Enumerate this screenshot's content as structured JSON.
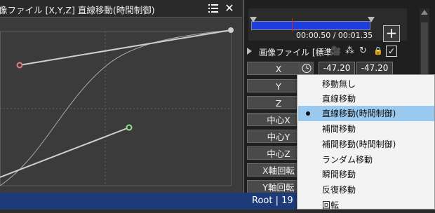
{
  "curve_editor": {
    "title": "像ファイル [X,Y,Z] 直線移動(時間制御)",
    "list_icon": "list-icon",
    "close_icon": "close-icon",
    "close_glyph": "✕"
  },
  "timeline": {
    "time_display": "00:00.50 / 00:01.35",
    "add_label": "+"
  },
  "object": {
    "name": "画像ファイル [標準",
    "icons": [
      "expand-triangle-icon",
      "camera-icon",
      "scatter-icon",
      "refresh-icon",
      "lock-icon",
      "check-icon"
    ],
    "camera_glyph": "🎥",
    "scatter_glyph": "⁂",
    "refresh_glyph": "↻",
    "lock_glyph": "🔒",
    "check_glyph": "✓"
  },
  "properties": {
    "buttons": [
      "X",
      "Y",
      "Z",
      "中心X",
      "中心Y",
      "中心Z",
      "X軸回転",
      "Y軸回転"
    ],
    "x_start": "-47.20",
    "x_end": "-47.20"
  },
  "context_menu": {
    "items": [
      "移動無し",
      "直線移動",
      "直線移動(時間制御)",
      "補間移動",
      "補間移動(時間制御)",
      "ランダム移動",
      "瞬間移動",
      "反復移動",
      "回転"
    ],
    "selected_index": 2
  },
  "status_bar": {
    "text": "Root  |  19"
  },
  "colors": {
    "timeline_track": "#1d3ddf",
    "timeline_marker": "#e02020",
    "status_bar": "#1c3b78",
    "menu_selected": "#99c9ef",
    "control_point_start": "#e08080",
    "control_point_end": "#90e090"
  }
}
